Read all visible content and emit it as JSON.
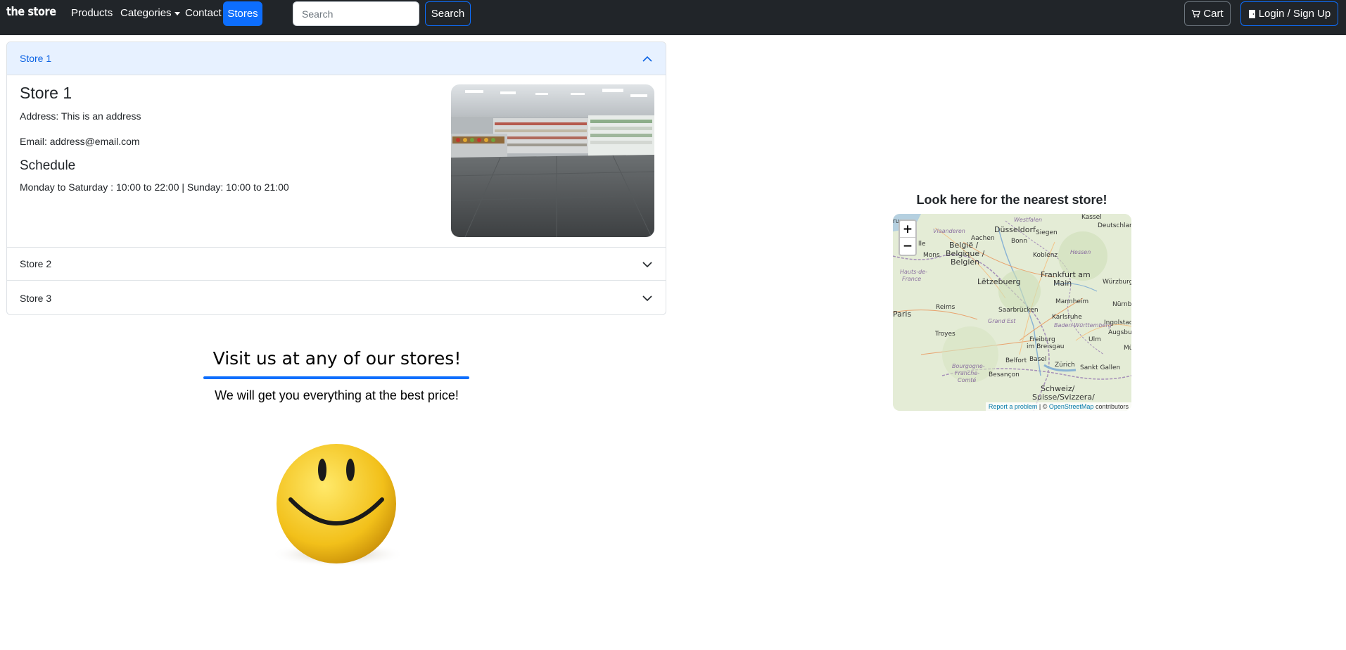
{
  "navbar": {
    "brand": "the store",
    "links": {
      "products": "Products",
      "categories": "Categories",
      "contact": "Contact",
      "stores": "Stores"
    },
    "search": {
      "placeholder": "Search",
      "button": "Search"
    },
    "cart": "Cart",
    "login": "Login / Sign Up"
  },
  "accordion": {
    "items": [
      {
        "header": "Store 1",
        "title": "Store 1",
        "address": "Address: This is an address",
        "email": "Email: address@email.com",
        "schedule_title": "Schedule",
        "schedule": "Monday to Saturday : 10:00 to 22:00 | Sunday: 10:00 to 21:00"
      },
      {
        "header": "Store 2"
      },
      {
        "header": "Store 3"
      }
    ]
  },
  "hero": {
    "title": "Visit us at any of our stores!",
    "subtitle": "We will get you everything at the best price!"
  },
  "map": {
    "title": "Look here for the nearest store!",
    "zoom_in": "+",
    "zoom_out": "−",
    "attribution": {
      "report": "Report a problem",
      "separator": "| ©",
      "osm": "OpenStreetMap",
      "contributors": "contributors"
    },
    "labels": {
      "kassel": "Kassel",
      "deutschland": "Deutschland",
      "dusseldorf": "Düsseldorf",
      "siegen": "Siegen",
      "aachen": "Aachen",
      "bonn": "Bonn",
      "westfalen": "Westfalen",
      "hessen": "Hessen",
      "belgie": "België /",
      "belgique": "Belgique /",
      "belgien": "Belgien",
      "koblenz": "Koblenz",
      "mons": "Mons",
      "lille": "lle",
      "brugge": "ruge",
      "vlaanderen": "Vlaanderen",
      "frankfurt": "Frankfurt am",
      "main": "Main",
      "wurzburg": "Würzburg",
      "letzebuerg": "Lëtzebuerg",
      "hauts": "Hauts-de-",
      "france": "France",
      "nurnberg": "Nürnbe",
      "mannheim": "Mannheim",
      "reims": "Reims",
      "saarbrucken": "Saarbrücken",
      "paris": "Paris",
      "karlsruhe": "Karlsruhe",
      "grand_est": "Grand Est",
      "ingolstadt": "Ingolstadt",
      "bw": "Baden-Württemberg",
      "augsburg": "Augsburg",
      "troyes": "Troyes",
      "ulm": "Ulm",
      "freiburg": "Freiburg",
      "breisgau": "im Breisgau",
      "mu": "Mü",
      "belfort": "Belfort",
      "basel": "Basel",
      "bourgogne": "Bourgogne-",
      "franche": "Franche-",
      "comte": "Comté",
      "zurich": "Zürich",
      "sankt_gallen": "Sankt Gallen",
      "besancon": "Besançon",
      "schweiz": "Schweiz/",
      "suisse": "Suisse/Svizzera/"
    }
  },
  "colors": {
    "navbar_bg": "#212529",
    "primary": "#0d6efd",
    "accordion_active_bg": "#e7f1ff",
    "accordion_active_text": "#0c63e4"
  }
}
